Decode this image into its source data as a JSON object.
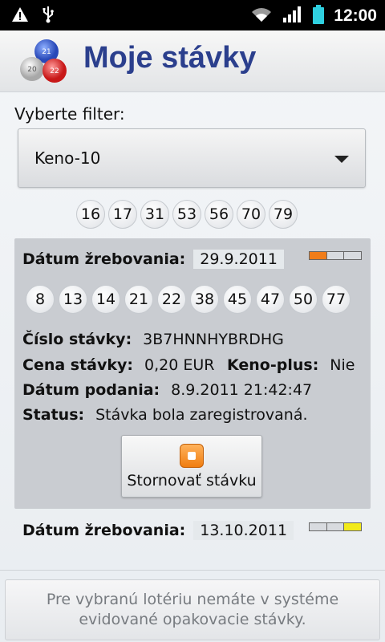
{
  "status_bar": {
    "time": "12:00"
  },
  "app": {
    "title": "Moje stávky",
    "logo_balls": [
      "21",
      "20",
      "22"
    ]
  },
  "filter": {
    "label": "Vyberte filter:",
    "selected": "Keno-10"
  },
  "drawn_numbers": [
    "16",
    "17",
    "31",
    "53",
    "56",
    "70",
    "79"
  ],
  "bets": [
    {
      "draw_date_label": "Dátum žrebovania:",
      "draw_date": "29.9.2011",
      "progress": {
        "filled": 1,
        "total": 3,
        "color": "#f07d1a"
      },
      "numbers": [
        "8",
        "13",
        "14",
        "21",
        "22",
        "38",
        "45",
        "47",
        "50",
        "77"
      ],
      "ticket_label": "Číslo stávky:",
      "ticket": "3B7HNNHYBRDHG",
      "price_label": "Cena stávky:",
      "price": "0,20 EUR",
      "keno_plus_label": "Keno-plus:",
      "keno_plus": "Nie",
      "submitted_label": "Dátum podania:",
      "submitted": "8.9.2011 21:42:47",
      "status_label": "Status:",
      "status": "Stávka bola zaregistrovaná.",
      "cancel_label": "Stornovať stávku"
    },
    {
      "draw_date_label": "Dátum žrebovania:",
      "draw_date": "13.10.2011",
      "progress": {
        "filled": 1,
        "total": 3,
        "color": "#f2ea1a"
      }
    }
  ],
  "footer": {
    "message": "Pre vybranú lotériu nemáte v systéme evidované opakovacie stávky."
  }
}
